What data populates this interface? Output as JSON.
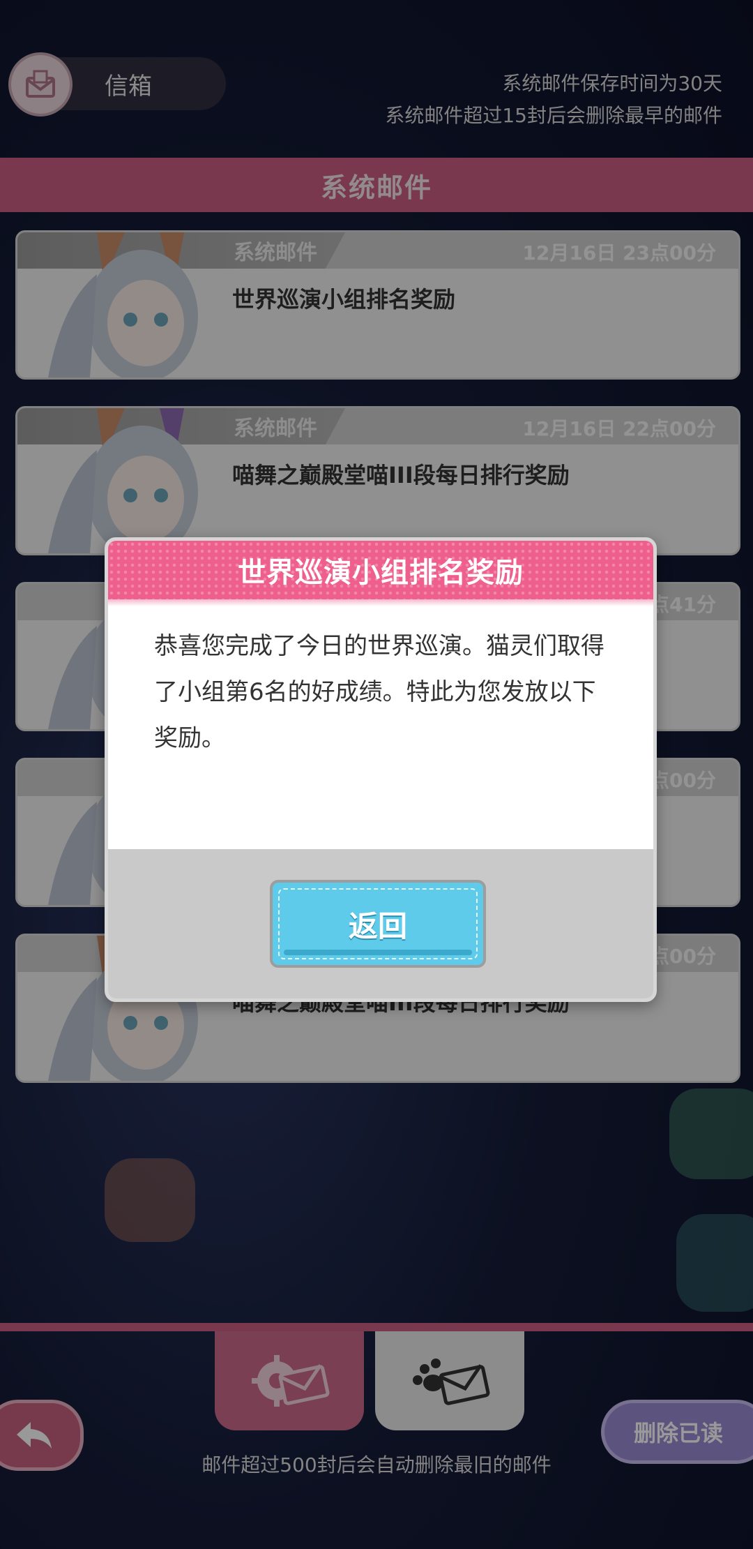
{
  "header": {
    "inbox_title": "信箱",
    "notice_line1": "系统邮件保存时间为30天",
    "notice_line2": "系统邮件超过15封后会删除最早的邮件"
  },
  "section_title": "系统邮件",
  "mails": [
    {
      "tag": "系统邮件",
      "date": "12月16日 23点00分",
      "subject": "世界巡演小组排名奖励"
    },
    {
      "tag": "系统邮件",
      "date": "12月16日 22点00分",
      "subject": "喵舞之巅殿堂喵III段每日排行奖励"
    },
    {
      "tag": "",
      "date": "点41分",
      "subject": ""
    },
    {
      "tag": "",
      "date": "点00分",
      "subject": ""
    },
    {
      "tag": "",
      "date": "点00分",
      "subject": "喵舞之巅殿堂喵III段每日排行奖励"
    }
  ],
  "modal": {
    "title": "世界巡演小组排名奖励",
    "body": "恭喜您完成了今日的世界巡演。猫灵们取得了小组第6名的好成绩。特此为您发放以下奖励。",
    "back_button": "返回"
  },
  "bottom": {
    "delete_read": "删除已读",
    "footer_notice": "邮件超过500封后会自动删除最旧的邮件"
  },
  "colors": {
    "brand_pink": "#ca5e80",
    "modal_header": "#ee5f8e",
    "button_cyan": "#5ecbea",
    "delete_purple": "#9a8ad3"
  }
}
